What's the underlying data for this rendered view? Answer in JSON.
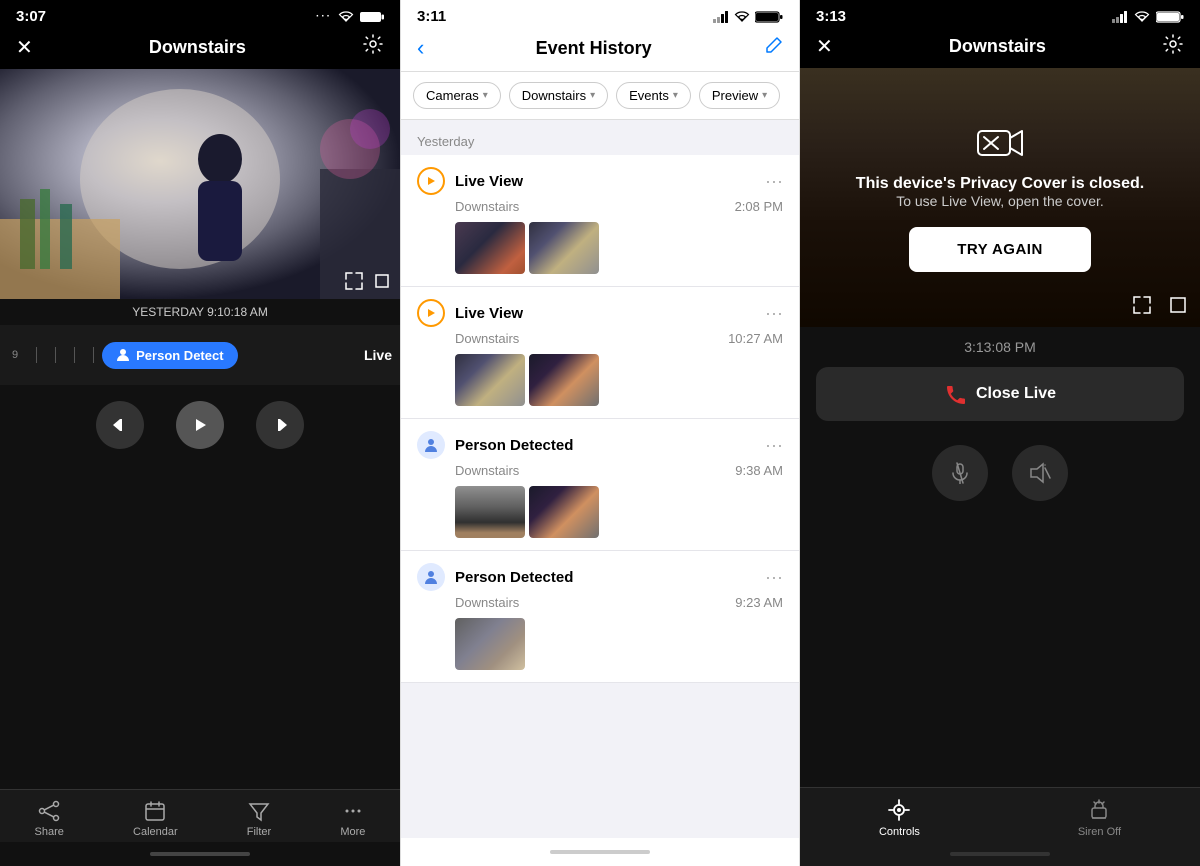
{
  "panel_left": {
    "status_bar": {
      "time": "3:07",
      "signal": "···",
      "wifi": "WiFi",
      "battery": "🔋"
    },
    "nav": {
      "title": "Downstairs",
      "back_label": "✕",
      "settings_label": "⚙"
    },
    "timestamp": "YESTERDAY 9:10:18 AM",
    "timeline": {
      "pill_label": "Person Detect",
      "live_label": "Live"
    },
    "controls": {
      "skip_back": "⏮",
      "play": "▶",
      "skip_forward": "⏭"
    },
    "bottom_nav": [
      {
        "icon": "↗",
        "label": "Share"
      },
      {
        "icon": "📅",
        "label": "Calendar"
      },
      {
        "icon": "▽",
        "label": "Filter"
      },
      {
        "icon": "•••",
        "label": "More"
      }
    ]
  },
  "panel_middle": {
    "status_bar": {
      "time": "3:11"
    },
    "nav": {
      "title": "Event History",
      "back_label": "‹",
      "edit_label": "✏"
    },
    "filters": [
      {
        "label": "Cameras",
        "has_arrow": true
      },
      {
        "label": "Downstairs",
        "has_arrow": true
      },
      {
        "label": "Events",
        "has_arrow": true
      },
      {
        "label": "Preview",
        "has_arrow": true
      }
    ],
    "section_header": "Yesterday",
    "events": [
      {
        "type": "live",
        "icon": "▶",
        "title": "Live View",
        "location": "Downstairs",
        "time": "2:08 PM"
      },
      {
        "type": "live",
        "icon": "▶",
        "title": "Live View",
        "location": "Downstairs",
        "time": "10:27 AM"
      },
      {
        "type": "person",
        "icon": "👤",
        "title": "Person Detected",
        "location": "Downstairs",
        "time": "9:38 AM"
      },
      {
        "type": "person",
        "icon": "👤",
        "title": "Person Detected",
        "location": "Downstairs",
        "time": "9:23 AM"
      }
    ]
  },
  "panel_right": {
    "status_bar": {
      "time": "3:13"
    },
    "nav": {
      "title": "Downstairs",
      "close_label": "✕",
      "settings_label": "⚙"
    },
    "privacy": {
      "icon": "📷",
      "title": "This device's Privacy Cover is closed.",
      "subtitle": "To use Live View, open the cover.",
      "button_label": "TRY AGAIN"
    },
    "live_timestamp": "3:13:08 PM",
    "close_live_label": "Close Live",
    "bottom_nav": [
      {
        "icon": "⊙",
        "label": "Controls",
        "active": true
      },
      {
        "icon": "≋",
        "label": "Siren Off",
        "active": false
      }
    ]
  }
}
